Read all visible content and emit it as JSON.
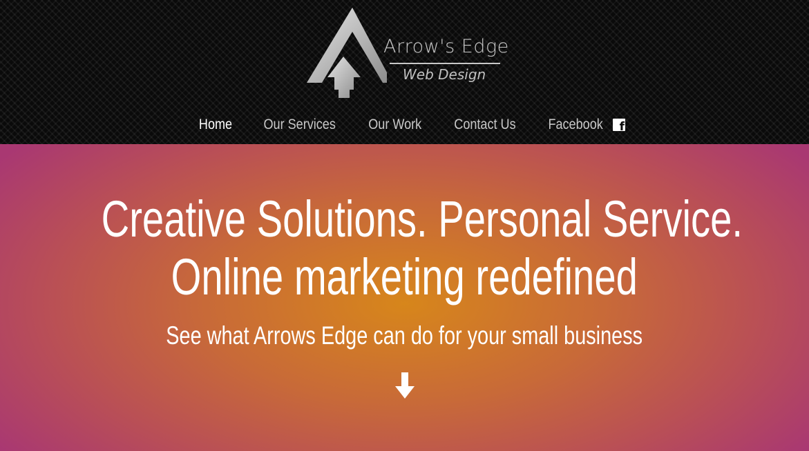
{
  "brand": {
    "name": "Arrow's Edge",
    "tagline": "Web Design",
    "logo_icon": "arrow-mark-logo",
    "logo_color": "#c8c8c8"
  },
  "nav": {
    "items": [
      {
        "label": "Home",
        "active": true
      },
      {
        "label": "Our Services",
        "active": false
      },
      {
        "label": "Our Work",
        "active": false
      },
      {
        "label": "Contact Us",
        "active": false
      },
      {
        "label": "Facebook",
        "active": false,
        "icon": "facebook-icon"
      }
    ]
  },
  "hero": {
    "headline_line1": "Creative Solutions. Personal Service.",
    "headline_line2": "Online marketing redefined",
    "subheadline": "See what Arrows Edge can do for your small business",
    "scroll_icon": "arrow-down-icon",
    "gradient_center": "#d7861b",
    "gradient_edge": "#a93872"
  },
  "colors": {
    "header_bg": "#0a0a0a",
    "text": "#ffffff",
    "nav_text": "#c8c8c8"
  }
}
